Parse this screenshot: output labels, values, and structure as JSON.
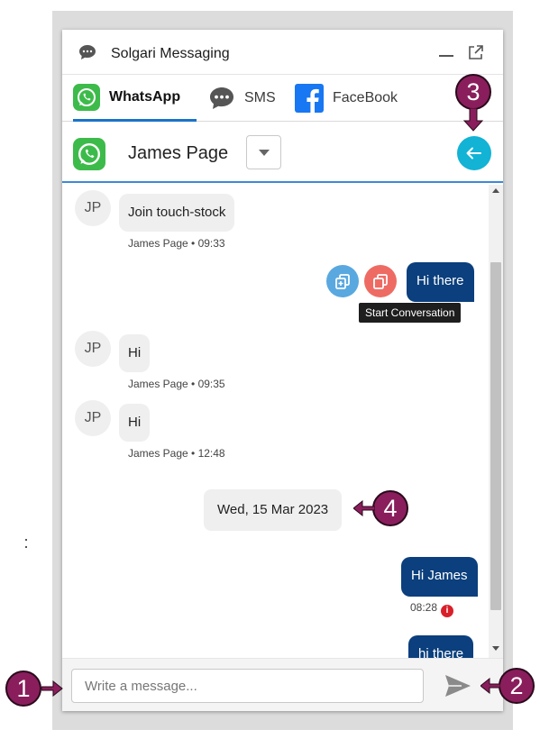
{
  "app": {
    "title": "Solgari Messaging"
  },
  "tabs": [
    {
      "label": "WhatsApp",
      "icon": "whatsapp-icon",
      "active": true
    },
    {
      "label": "SMS",
      "icon": "sms-bubble-icon",
      "active": false
    },
    {
      "label": "FaceBook",
      "icon": "facebook-icon",
      "active": false
    }
  ],
  "contact": {
    "name": "James Page",
    "initials": "JP"
  },
  "messages": [
    {
      "direction": "in",
      "text": "Join touch-stock",
      "meta": "James Page • 09:33"
    },
    {
      "direction": "out",
      "text": "Hi there"
    },
    {
      "direction": "in",
      "text": "Hi",
      "meta": "James Page • 09:35"
    },
    {
      "direction": "in",
      "text": "Hi",
      "meta": "James Page • 12:48"
    },
    {
      "direction": "divider",
      "text": "Wed, 15 Mar 2023"
    },
    {
      "direction": "out",
      "text": "Hi James",
      "meta": "08:28",
      "error": true
    },
    {
      "direction": "out",
      "text": "hi there"
    }
  ],
  "tooltip": "Start Conversation",
  "composer": {
    "placeholder": "Write a message..."
  },
  "callouts": [
    "1",
    "2",
    "3",
    "4"
  ],
  "colors": {
    "accent": "#12b3d5",
    "outgoing_bubble": "#0b3f7d",
    "tab_underline": "#1a73c8",
    "callout": "#8a1e5c",
    "whatsapp": "#3dbb4a",
    "facebook": "#1877f2",
    "new_conversation_button": "#5aa8e0",
    "start_conversation_button": "#ee6b63"
  }
}
